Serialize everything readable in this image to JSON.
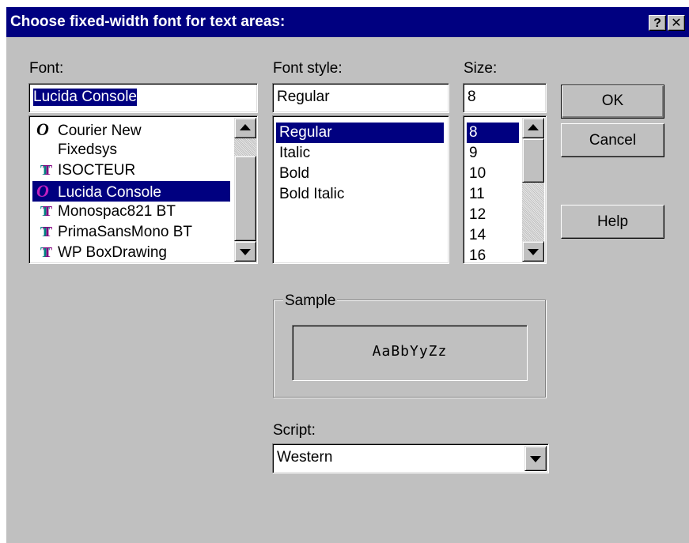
{
  "dialog": {
    "title": "Choose fixed-width font for text areas:",
    "help_glyph": "?",
    "close_glyph": "✕"
  },
  "font": {
    "label": "Font:",
    "value": "Lucida Console",
    "items": [
      {
        "name": "Courier New",
        "icon": "opentype-icon",
        "glyph": "O"
      },
      {
        "name": "Fixedsys",
        "icon": "",
        "glyph": ""
      },
      {
        "name": "ISOCTEUR",
        "icon": "truetype-icon",
        "glyph": "T"
      },
      {
        "name": "Lucida Console",
        "icon": "opentype-icon",
        "glyph": "O",
        "selected": true
      },
      {
        "name": "Monospac821 BT",
        "icon": "truetype-icon",
        "glyph": "T"
      },
      {
        "name": "PrimaSansMono BT",
        "icon": "truetype-icon",
        "glyph": "T"
      },
      {
        "name": "WP BoxDrawing",
        "icon": "truetype-icon",
        "glyph": "T"
      }
    ]
  },
  "style": {
    "label": "Font style:",
    "value": "Regular",
    "items": [
      "Regular",
      "Italic",
      "Bold",
      "Bold Italic"
    ],
    "selected": "Regular"
  },
  "size": {
    "label": "Size:",
    "value": "8",
    "items": [
      "8",
      "9",
      "10",
      "11",
      "12",
      "14",
      "16"
    ],
    "selected": "8"
  },
  "buttons": {
    "ok": "OK",
    "cancel": "Cancel",
    "help": "Help"
  },
  "sample": {
    "label": "Sample",
    "text": "AaBbYyZz"
  },
  "script": {
    "label": "Script:",
    "value": "Western"
  },
  "colors": {
    "title_bar": "#000080",
    "face": "#c0c0c0",
    "selection": "#000080"
  }
}
